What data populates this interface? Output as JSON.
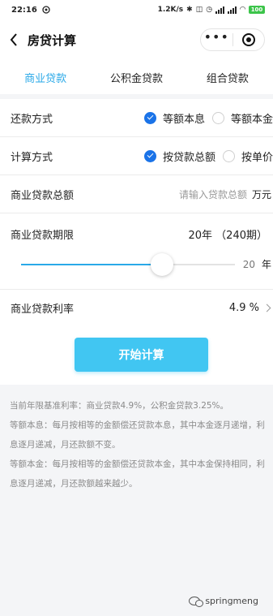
{
  "status_bar": {
    "time": "22:16",
    "network_speed": "1.2K/s",
    "battery": "100"
  },
  "nav": {
    "title": "房贷计算",
    "more_icon": "more-dots-icon",
    "close_icon": "target-circle-icon"
  },
  "tabs": [
    {
      "label": "商业贷款",
      "active": true
    },
    {
      "label": "公积金贷款",
      "active": false
    },
    {
      "label": "组合贷款",
      "active": false
    }
  ],
  "repayment": {
    "label": "还款方式",
    "options": [
      {
        "label": "等额本息",
        "checked": true
      },
      {
        "label": "等额本金",
        "checked": false
      }
    ]
  },
  "calc_method": {
    "label": "计算方式",
    "options": [
      {
        "label": "按贷款总额",
        "checked": true
      },
      {
        "label": "按单价",
        "checked": false
      }
    ]
  },
  "loan_amount": {
    "label": "商业贷款总额",
    "placeholder": "请输入贷款总额",
    "unit": "万元"
  },
  "loan_period": {
    "label": "商业贷款期限",
    "value": "20年 （240期）",
    "slider_value": "20",
    "slider_unit": "年",
    "slider_fraction": 0.66
  },
  "loan_rate": {
    "label": "商业贷款利率",
    "value": "4.9 %"
  },
  "calculate_button": "开始计算",
  "notes": [
    "当前年限基准利率：商业贷款4.9%，公积金贷款3.25%。",
    "等额本息：每月按相等的金额偿还贷款本息，其中本金逐月递增，利息逐月递减，月还款额不变。",
    "等额本金：每月按相等的金额偿还贷款本金，其中本金保持相同，利息逐月递减，月还款额越来越少。"
  ],
  "watermark": "springmeng",
  "colors": {
    "accent": "#2aa9e8",
    "button": "#41c6f2",
    "radio_checked": "#1a73e8",
    "battery": "#3cc44a"
  }
}
